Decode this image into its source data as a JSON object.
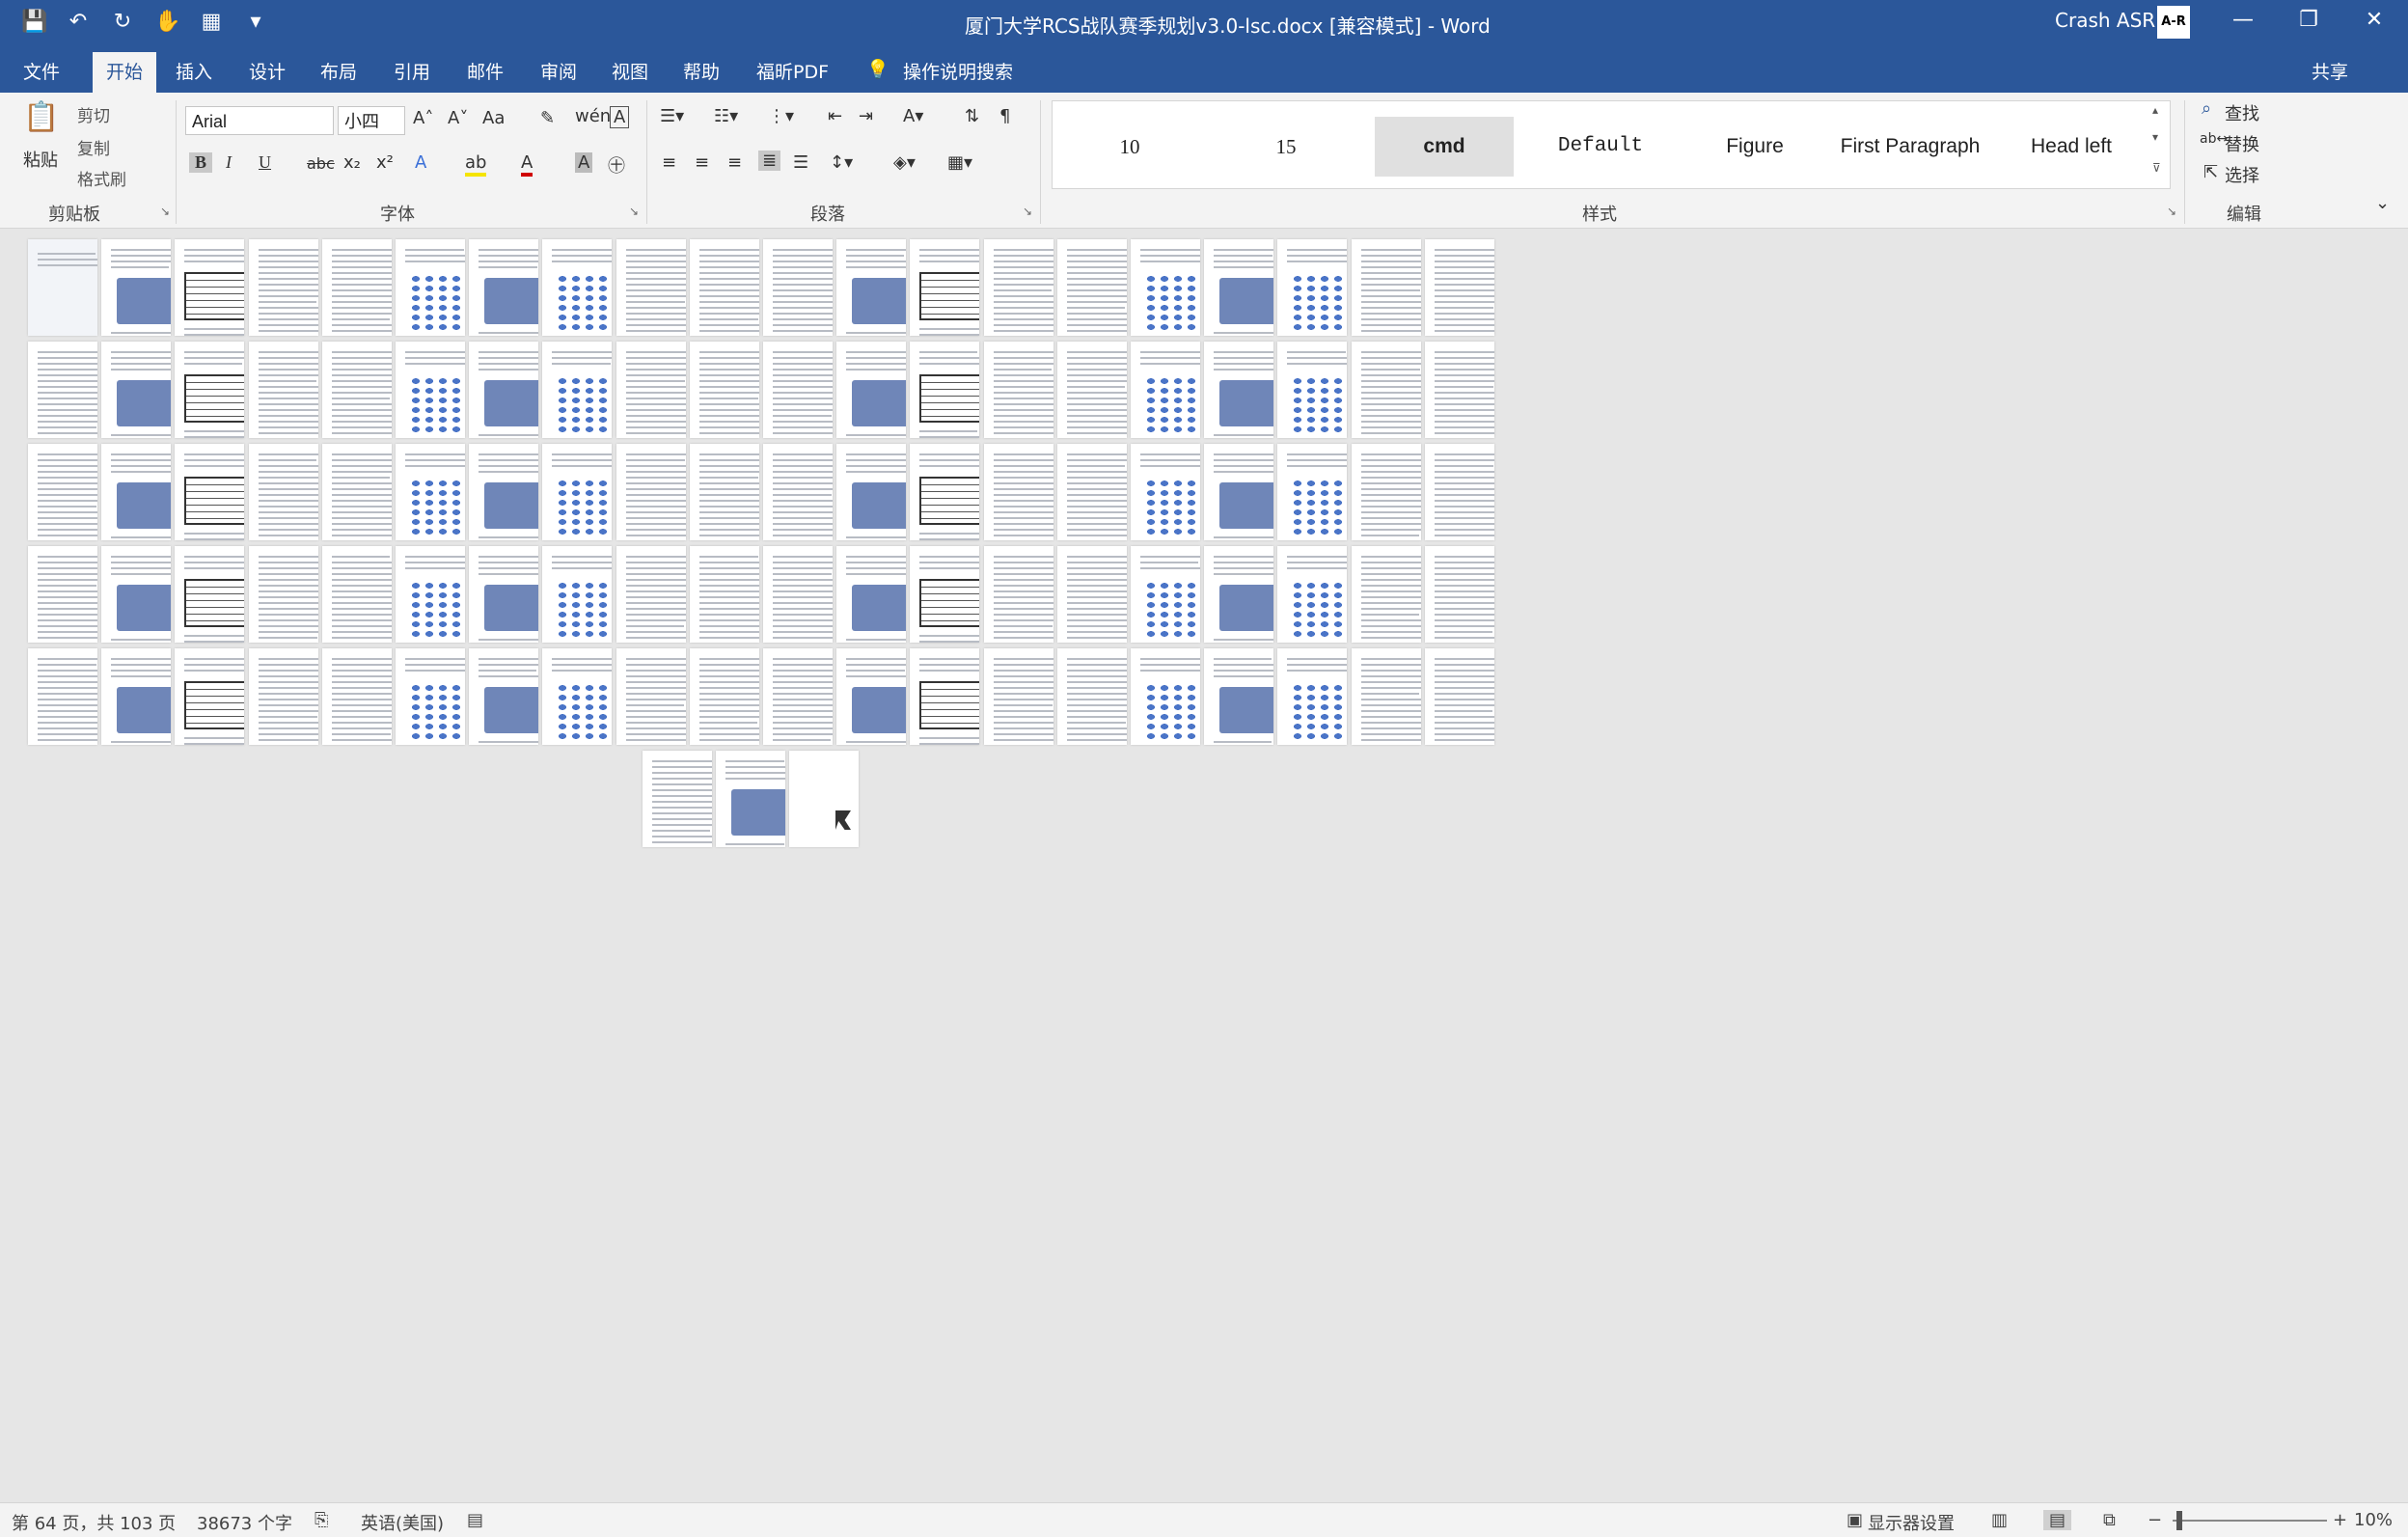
{
  "window": {
    "title": "厦门大学RCS战队赛季规划v3.0-lsc.docx [兼容模式] - Word",
    "user": "Crash ASR",
    "avatar_text": "A-R",
    "min_glyph": "—",
    "max_glyph": "❐",
    "close_glyph": "✕"
  },
  "qat": {
    "save": "💾",
    "undo": "↶",
    "redo": "↻",
    "touch": "✋",
    "table": "▦",
    "more": "▾"
  },
  "tabs": [
    "文件",
    "开始",
    "插入",
    "设计",
    "布局",
    "引用",
    "邮件",
    "审阅",
    "视图",
    "帮助",
    "福昕PDF",
    "操作说明搜索"
  ],
  "share": "共享",
  "clipboard": {
    "paste": "粘贴",
    "cut": "剪切",
    "copy": "复制",
    "format_painter": "格式刷",
    "label": "剪贴板"
  },
  "font": {
    "name": "Arial",
    "size": "小四",
    "bold": "B",
    "italic": "I",
    "underline": "U",
    "strike": "abc",
    "label": "字体"
  },
  "paragraph": {
    "label": "段落"
  },
  "styles": {
    "items": [
      "10",
      "15",
      "cmd",
      "Default",
      "Figure",
      "First Paragraph",
      "Head left"
    ],
    "label": "样式"
  },
  "editing": {
    "find": "查找",
    "replace": "替换",
    "select": "选择",
    "label": "编辑"
  },
  "status": {
    "page": "第 64 页，共 103 页",
    "words": "38673 个字",
    "language": "英语(美国)",
    "display": "显示器设置",
    "zoom": "10%"
  },
  "document": {
    "page_count": 103
  }
}
